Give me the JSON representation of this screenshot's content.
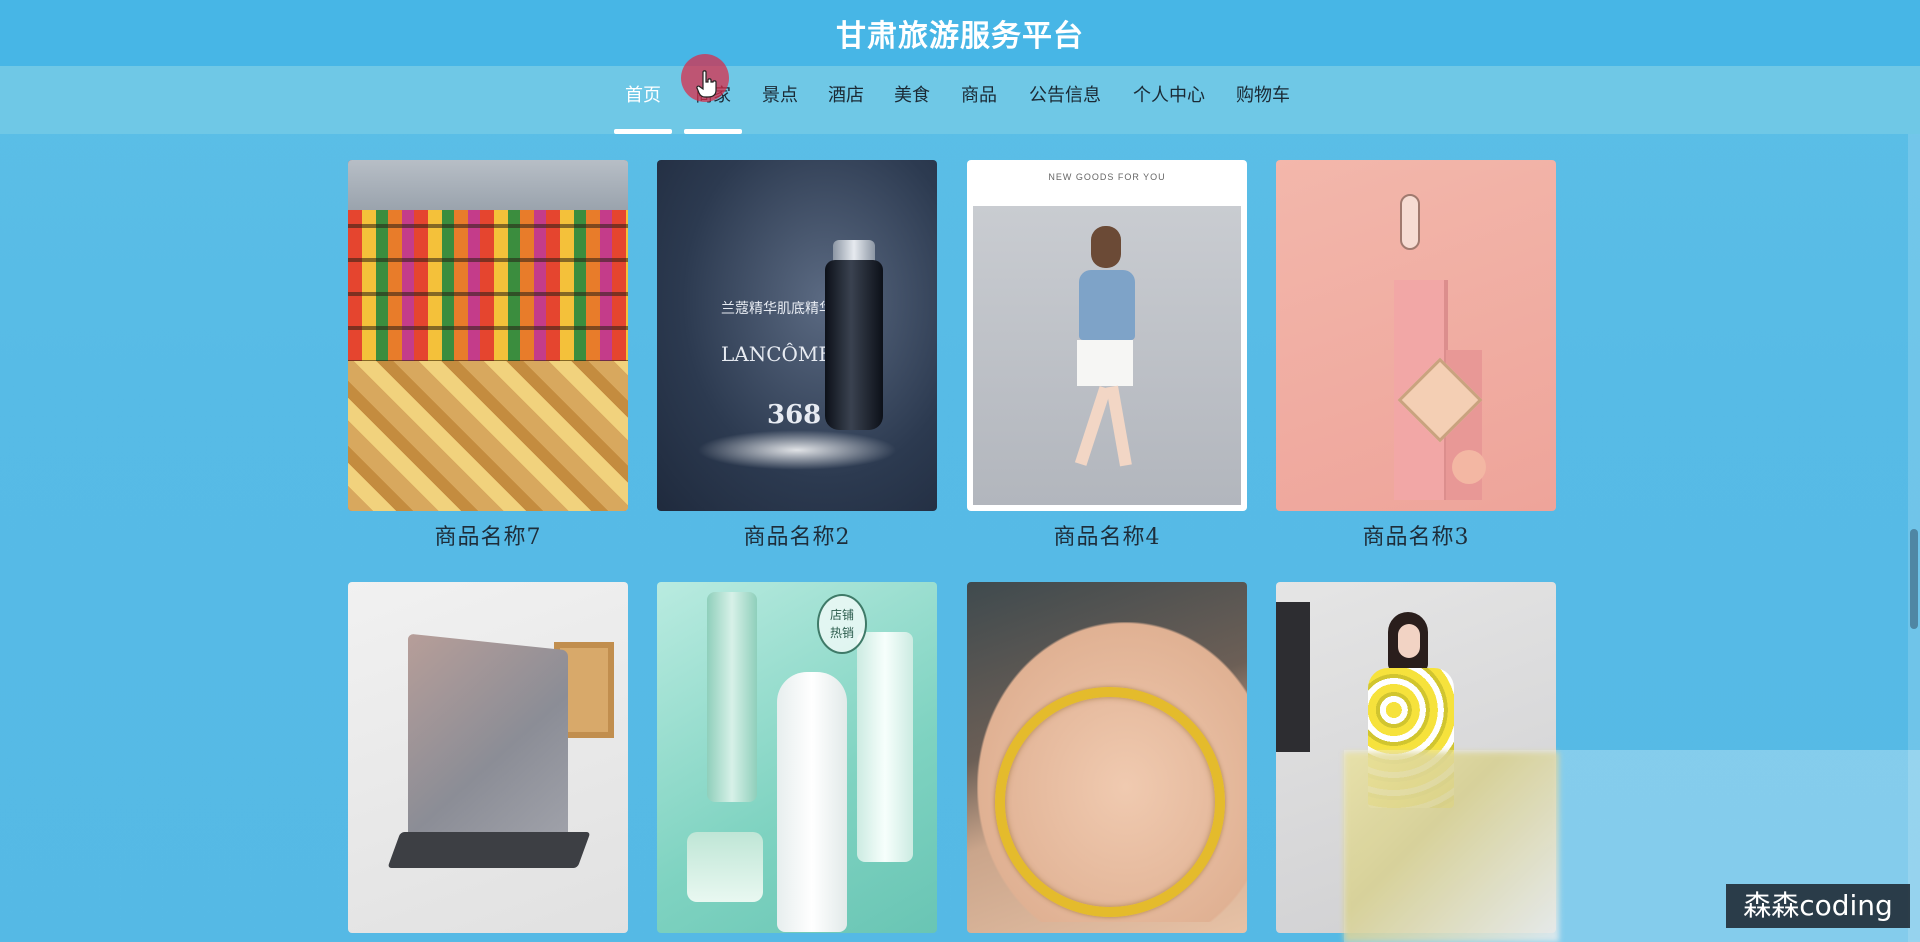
{
  "header": {
    "title": "甘肃旅游服务平台"
  },
  "nav": {
    "items": [
      {
        "label": "首页",
        "active": true
      },
      {
        "label": "商家",
        "active": false
      },
      {
        "label": "景点",
        "active": false
      },
      {
        "label": "酒店",
        "active": false
      },
      {
        "label": "美食",
        "active": false
      },
      {
        "label": "商品",
        "active": false
      },
      {
        "label": "公告信息",
        "active": false
      },
      {
        "label": "个人中心",
        "active": false
      },
      {
        "label": "购物车",
        "active": false
      }
    ]
  },
  "products": [
    {
      "name": "商品名称7",
      "image": "supermarket-shelves"
    },
    {
      "name": "商品名称2",
      "image": "lancome-serum"
    },
    {
      "name": "商品名称4",
      "image": "fashion-model"
    },
    {
      "name": "商品名称3",
      "image": "makeup-palette"
    },
    {
      "name": "",
      "image": "gaming-laptop"
    },
    {
      "name": "",
      "image": "skincare-bottles"
    },
    {
      "name": "",
      "image": "gold-bangle"
    },
    {
      "name": "",
      "image": "floral-dress"
    }
  ],
  "image_text": {
    "lancome_headline": "兰蔻精华肌底精华液",
    "lancome_brand": "LANCÔME",
    "lancome_price": "368",
    "fashion_header": "NEW GOODS FOR YOU",
    "skincare_badge_line1": "店铺",
    "skincare_badge_line2": "热销"
  },
  "watermark": "森森coding",
  "colors": {
    "header_bg": "#47b6e6",
    "nav_bg": "#6fc8e6",
    "page_bg": "#57bbe6",
    "nav_active_text": "#ffffff"
  }
}
